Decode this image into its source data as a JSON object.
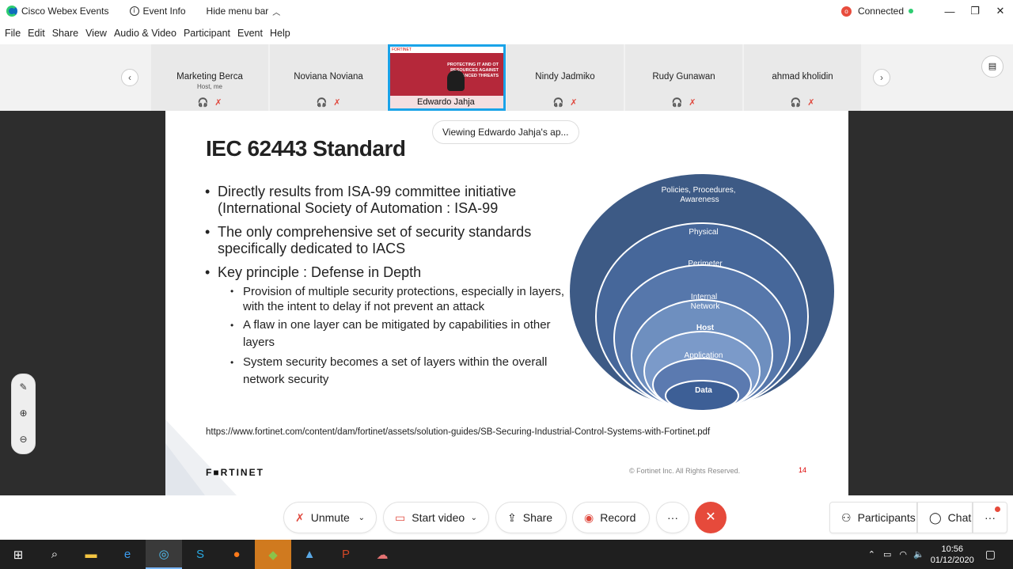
{
  "titlebar": {
    "app_name": "Cisco Webex Events",
    "event_info": "Event Info",
    "hide_menu": "Hide menu bar",
    "status_badge": "o",
    "connection": "Connected",
    "minimize": "—",
    "maximize": "❐",
    "close": "✕"
  },
  "menu": [
    "File",
    "Edit",
    "Share",
    "View",
    "Audio & Video",
    "Participant",
    "Event",
    "Help"
  ],
  "participants": [
    {
      "name": "Marketing Berca",
      "sub": "Host, me"
    },
    {
      "name": "Noviana Noviana",
      "sub": ""
    },
    {
      "name": "Nindy Jadmiko",
      "sub": ""
    },
    {
      "name": "Rudy Gunawan",
      "sub": ""
    },
    {
      "name": "ahmad kholidin",
      "sub": ""
    }
  ],
  "active_speaker": {
    "name": "Edwardo Jahja",
    "slide_text": "PROTECTING IT AND OT RESOURCES AGAINST ADVANCED THREATS",
    "brand": "FORTINET"
  },
  "viewing_label": "Viewing Edwardo Jahja's ap...",
  "slide": {
    "title": "IEC 62443 Standard",
    "bullets": [
      {
        "text": "Directly results from ISA-99 committee initiative (International Society of Automation : ISA-99",
        "level": 1
      },
      {
        "text": "The only comprehensive set of security standards specifically dedicated to IACS",
        "level": 1
      },
      {
        "text": "Key principle : Defense in Depth",
        "level": 1
      },
      {
        "text": "Provision of multiple security protections, especially in layers, with the intent to delay if not prevent an attack",
        "level": 2
      },
      {
        "text": "A flaw in one layer can be mitigated by capabilities in other layers",
        "level": 2
      },
      {
        "text": "System security becomes a set of layers within the overall network security",
        "level": 2
      }
    ],
    "layers": [
      {
        "label": "Policies, Procedures, Awareness",
        "color": "#3d5a85"
      },
      {
        "label": "Physical",
        "color": "#46679a"
      },
      {
        "label": "Perimeter",
        "color": "#5677ab"
      },
      {
        "label": "Internal Network",
        "color": "#6e8fbf"
      },
      {
        "label": "Host",
        "color": "#7b9ac9"
      },
      {
        "label": "Application",
        "color": "#5b7ab0"
      },
      {
        "label": "Data",
        "color": "#3d5f96"
      }
    ],
    "url": "https://www.fortinet.com/content/dam/fortinet/assets/solution-guides/SB-Securing-Industrial-Control-Systems-with-Fortinet.pdf",
    "logo": "F■RTINET",
    "copyright": "© Fortinet Inc. All Rights Reserved.",
    "page_number": "14"
  },
  "controls": {
    "unmute": "Unmute",
    "start_video": "Start video",
    "share": "Share",
    "record": "Record",
    "more": "···",
    "participants": "Participants",
    "chat": "Chat"
  },
  "taskbar": {
    "time": "10:56",
    "date": "01/12/2020"
  }
}
